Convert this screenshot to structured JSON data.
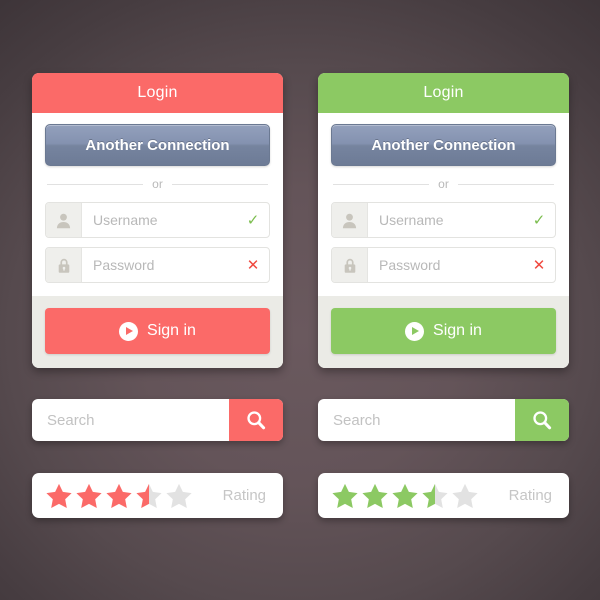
{
  "theme": {
    "background": "#645459",
    "red": "#fb6a68",
    "green": "#8cc963",
    "connection_button": "#8492b0",
    "card_body": "#ffffff",
    "card_footer": "#ebebe6",
    "valid_check": "#7bbd4e",
    "invalid_cross": "#f0493f",
    "star_empty": "#e2e2e2",
    "placeholder_text": "#b8b8b8"
  },
  "panels": [
    {
      "accent_name": "red",
      "accent": "#fb6a68",
      "login_card": {
        "title": "Login",
        "connection_button_label": "Another Connection",
        "divider_label": "or",
        "fields": [
          {
            "name": "username",
            "icon": "user-icon",
            "placeholder": "Username",
            "state": "valid",
            "state_glyph": "✓"
          },
          {
            "name": "password",
            "icon": "lock-icon",
            "placeholder": "Password",
            "state": "invalid",
            "state_glyph": "✕"
          }
        ],
        "submit_label": "Sign in",
        "submit_icon": "play-circle-icon"
      },
      "search": {
        "placeholder": "Search",
        "value": "",
        "button_icon": "search-icon"
      },
      "rating": {
        "label": "Rating",
        "value": 3.5,
        "max": 5,
        "stars": [
          "full",
          "full",
          "full",
          "half",
          "empty"
        ]
      }
    },
    {
      "accent_name": "green",
      "accent": "#8cc963",
      "login_card": {
        "title": "Login",
        "connection_button_label": "Another Connection",
        "divider_label": "or",
        "fields": [
          {
            "name": "username",
            "icon": "user-icon",
            "placeholder": "Username",
            "state": "valid",
            "state_glyph": "✓"
          },
          {
            "name": "password",
            "icon": "lock-icon",
            "placeholder": "Password",
            "state": "invalid",
            "state_glyph": "✕"
          }
        ],
        "submit_label": "Sign in",
        "submit_icon": "play-circle-icon"
      },
      "search": {
        "placeholder": "Search",
        "value": "",
        "button_icon": "search-icon"
      },
      "rating": {
        "label": "Rating",
        "value": 3.5,
        "max": 5,
        "stars": [
          "full",
          "full",
          "full",
          "half",
          "empty"
        ]
      }
    }
  ]
}
